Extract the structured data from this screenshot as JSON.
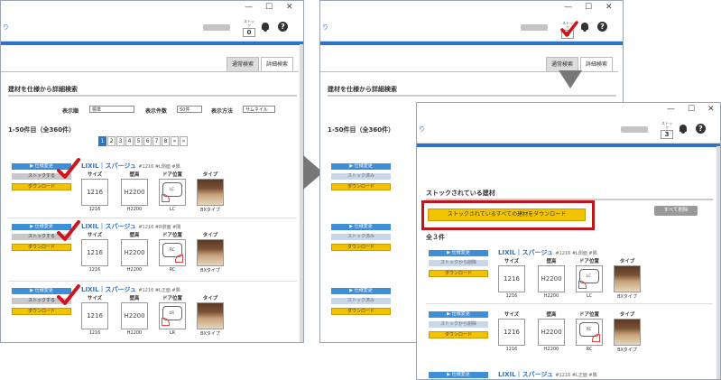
{
  "window_controls": {
    "min": "—",
    "max": "☐",
    "close": "✕"
  },
  "header": {
    "stock_label": "ストック",
    "stock_count_before": "0",
    "stock_count_after": "3",
    "left_glyph": "り"
  },
  "tabs": {
    "normal": "通常検索",
    "detail": "詳細検索"
  },
  "search": {
    "title": "建材を仕様から詳細検索",
    "order_label": "表示順",
    "order_value": "標準",
    "count_label": "表示件数",
    "count_value": "50件",
    "method_label": "表示方法",
    "method_value": "サムネイル",
    "result_count": "1-50件目（全360件）",
    "pages": [
      "1",
      "2",
      "3",
      "4",
      "5",
      "6",
      "7",
      "8",
      "»",
      "»"
    ]
  },
  "buttons": {
    "spec_change": "▶ 仕様変更",
    "stock": "ストックする",
    "stocked": "ストック済み",
    "remove_stock": "ストックから削除",
    "download": "ダウンロード",
    "download_all": "ストックされているすべての建材をダウンロード",
    "delete_all": "すべて削除"
  },
  "columns": {
    "size": "サイズ",
    "height": "壁高",
    "door": "ドア位置",
    "type": "タイプ"
  },
  "products": [
    {
      "brand": "LIXIL｜スパージュ",
      "detail": "#1216 #L側面 #隅",
      "size": "1216",
      "height": "H2200",
      "door": "LC",
      "type": "BXタイプ"
    },
    {
      "brand": "LIXIL｜スパージュ",
      "detail": "#1216 #R側面 #隅",
      "size": "1216",
      "height": "H2200",
      "door": "RC",
      "type": "BXタイプ"
    },
    {
      "brand": "LIXIL｜スパージュ",
      "detail": "#1216 #L正面 #隅",
      "size": "1216",
      "height": "H2200",
      "door": "LR",
      "type": "BXタイプ"
    }
  ],
  "stock_page": {
    "title": "ストックされている建材",
    "count": "全３件"
  },
  "colors": {
    "accent": "#2f73c6",
    "download_yellow": "#f4c300",
    "highlight_red": "#c0141c",
    "check_red": "#d0141c"
  }
}
